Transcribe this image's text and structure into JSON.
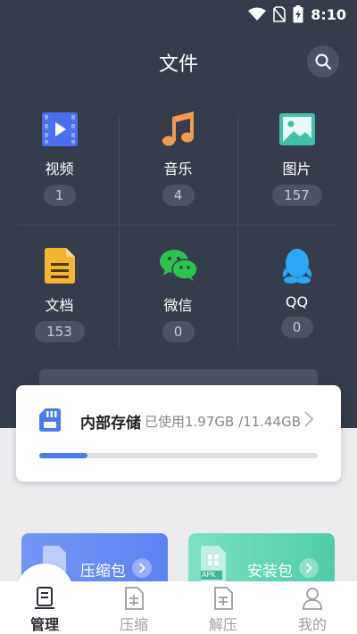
{
  "status_bar": {
    "time": "8:10"
  },
  "header": {
    "title": "文件"
  },
  "categories": [
    {
      "label": "视频",
      "count": "1"
    },
    {
      "label": "音乐",
      "count": "4"
    },
    {
      "label": "图片",
      "count": "157"
    },
    {
      "label": "文档",
      "count": "153"
    },
    {
      "label": "微信",
      "count": "0"
    },
    {
      "label": "QQ",
      "count": "0"
    }
  ],
  "storage": {
    "name": "内部存储",
    "usage": "已使用1.97GB /11.44GB",
    "used_fraction": 0.172
  },
  "tiles": [
    {
      "label": "压缩包"
    },
    {
      "label": "安装包",
      "badge": "APK"
    }
  ],
  "nav": [
    {
      "label": "管理",
      "active": true
    },
    {
      "label": "压缩",
      "active": false
    },
    {
      "label": "解压",
      "active": false
    },
    {
      "label": "我的",
      "active": false
    }
  ],
  "colors": {
    "header_bg": "#353d4c",
    "accent": "#4a7cf0",
    "tile_blue": "#6b8ff5",
    "tile_green": "#5dd4b2"
  }
}
